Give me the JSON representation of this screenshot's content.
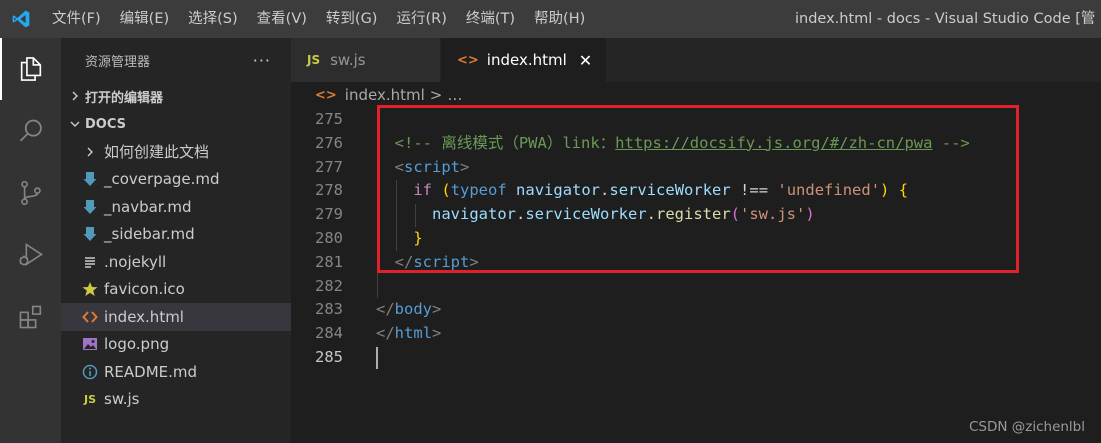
{
  "titlebar": {
    "menu": [
      "文件(F)",
      "编辑(E)",
      "选择(S)",
      "查看(V)",
      "转到(G)",
      "运行(R)",
      "终端(T)",
      "帮助(H)"
    ],
    "window_title": "index.html - docs - Visual Studio Code [管理员]"
  },
  "activitybar": {
    "items": [
      "explorer-icon",
      "search-icon",
      "source-control-icon",
      "run-debug-icon",
      "extensions-icon"
    ]
  },
  "sidebar": {
    "title": "资源管理器",
    "more": "···",
    "open_editors": "打开的编辑器",
    "folder": "DOCS",
    "items": [
      {
        "label": "如何创建此文档",
        "icon": "chevron-right-icon"
      },
      {
        "label": "_coverpage.md",
        "icon": "markdown-icon"
      },
      {
        "label": "_navbar.md",
        "icon": "markdown-icon"
      },
      {
        "label": "_sidebar.md",
        "icon": "markdown-icon"
      },
      {
        "label": ".nojekyll",
        "icon": "text-file-icon"
      },
      {
        "label": "favicon.ico",
        "icon": "star-icon"
      },
      {
        "label": "index.html",
        "icon": "html-icon"
      },
      {
        "label": "logo.png",
        "icon": "image-icon"
      },
      {
        "label": "README.md",
        "icon": "info-icon"
      },
      {
        "label": "sw.js",
        "icon": "js-icon"
      }
    ]
  },
  "editor": {
    "tabs": [
      {
        "badge": "JS",
        "label": "sw.js"
      },
      {
        "badge": "<>",
        "label": "index.html",
        "close": "✕"
      }
    ],
    "breadcrumb": {
      "badge": "<>",
      "file": "index.html",
      "sep": ">",
      "rest": "…"
    },
    "line_numbers": [
      "275",
      "276",
      "277",
      "278",
      "279",
      "280",
      "281",
      "282",
      "283",
      "284",
      "285"
    ],
    "code": {
      "l276_comment_start": "<!-- 离线模式（PWA）link：",
      "l276_link": "https://docsify.js.org/#/zh-cn/pwa",
      "l276_comment_end": " -->",
      "l277_tag": "script",
      "l278_if": "if",
      "l278_typeof": "typeof",
      "l278_nav": "navigator",
      "l278_sw": "serviceWorker",
      "l278_op": " !== ",
      "l278_str": "'undefined'",
      "l279_nav": "navigator",
      "l279_sw": "serviceWorker",
      "l279_fn": "register",
      "l279_str": "'sw.js'",
      "l281_tag": "script",
      "l283_tag": "body",
      "l284_tag": "html"
    }
  },
  "watermark": "CSDN @zichenlbl",
  "colors": {
    "accent_box": "#e0202a",
    "vscode_blue": "#23a9f2"
  }
}
